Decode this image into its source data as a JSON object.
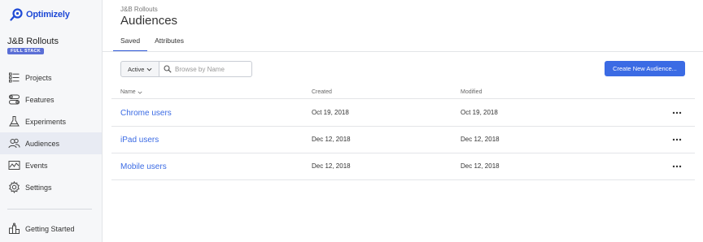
{
  "brand": {
    "name": "Optimizely",
    "accent": "#1f4ad6"
  },
  "project": {
    "name": "J&B Rollouts",
    "badge": "FULL STACK"
  },
  "sidebar": {
    "items": [
      {
        "label": "Projects",
        "icon": "projects-icon",
        "active": false
      },
      {
        "label": "Features",
        "icon": "features-icon",
        "active": false
      },
      {
        "label": "Experiments",
        "icon": "experiments-icon",
        "active": false
      },
      {
        "label": "Audiences",
        "icon": "audiences-icon",
        "active": true
      },
      {
        "label": "Events",
        "icon": "events-icon",
        "active": false
      },
      {
        "label": "Settings",
        "icon": "gear-icon",
        "active": false
      }
    ],
    "footer": {
      "label": "Getting Started",
      "icon": "getting-started-icon"
    }
  },
  "header": {
    "breadcrumb": "J&B Rollouts",
    "title": "Audiences"
  },
  "tabs": [
    {
      "label": "Saved",
      "active": true
    },
    {
      "label": "Attributes",
      "active": false
    }
  ],
  "toolbar": {
    "filter_value": "Active",
    "search_placeholder": "Browse by Name",
    "create_label": "Create New Audience..."
  },
  "table": {
    "columns": {
      "name": "Name",
      "created": "Created",
      "modified": "Modified"
    },
    "rows": [
      {
        "name": "Chrome users",
        "created": "Oct 19, 2018",
        "modified": "Oct 19, 2018"
      },
      {
        "name": "iPad users",
        "created": "Dec 12, 2018",
        "modified": "Dec 12, 2018"
      },
      {
        "name": "Mobile users",
        "created": "Dec 12, 2018",
        "modified": "Dec 12, 2018"
      }
    ]
  },
  "colors": {
    "link": "#3b6be4",
    "button": "#3b6be4",
    "badge": "#5b6fd6",
    "sidebar_bg": "#f6f7f9",
    "active_nav_bg": "#e8ebf3"
  }
}
